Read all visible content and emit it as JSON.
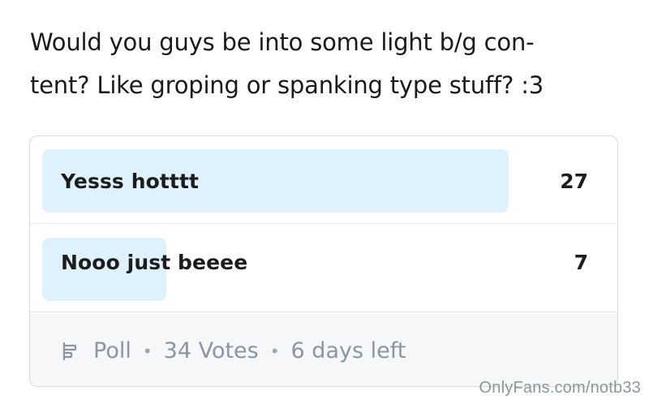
{
  "post": {
    "text_line_1": "Would you guys be into some light b/g con-",
    "text_line_2": "tent? Like groping or spanking type stuff? :3"
  },
  "poll": {
    "options": [
      {
        "label": "Yesss hotttt",
        "count": "27",
        "fraction": 0.79
      },
      {
        "label": "Nooo just beeee",
        "count": "7",
        "fraction": 0.21
      }
    ],
    "footer": {
      "icon": "poll-icon",
      "type_label": "Poll",
      "separator": "•",
      "votes": "34 Votes",
      "time_left": "6 days left"
    },
    "colors": {
      "fill": "#dff1fb",
      "border": "#d7dbe0",
      "footer_bg": "#f5f7f8",
      "muted_text": "#8a96a3"
    }
  },
  "watermark": "OnlyFans.com/notb33"
}
